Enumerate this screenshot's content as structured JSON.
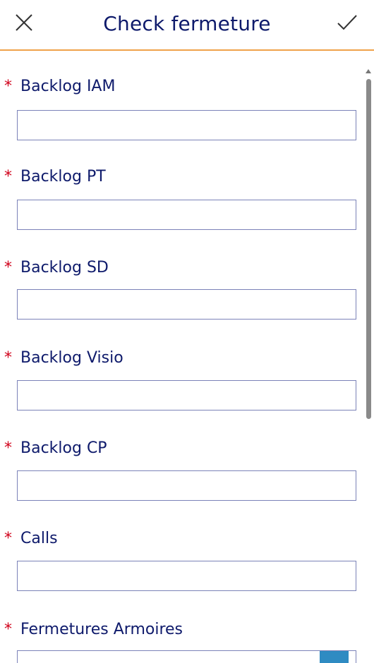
{
  "header": {
    "title": "Check fermeture",
    "close_icon": "close-icon",
    "confirm_icon": "checkmark-icon"
  },
  "form": {
    "required_mark": "*",
    "fields": [
      {
        "label": "Backlog IAM",
        "value": ""
      },
      {
        "label": "Backlog PT",
        "value": ""
      },
      {
        "label": "Backlog SD",
        "value": ""
      },
      {
        "label": "Backlog Visio",
        "value": ""
      },
      {
        "label": "Backlog CP",
        "value": ""
      },
      {
        "label": "Calls",
        "value": ""
      },
      {
        "label": "Fermetures Armoires",
        "value": ""
      }
    ]
  },
  "colors": {
    "accent_line": "#f0a24a",
    "label_text": "#0e1a6b",
    "required": "#d0021b",
    "input_border": "#7b82b8",
    "dropdown_button": "#2f8bc2"
  }
}
